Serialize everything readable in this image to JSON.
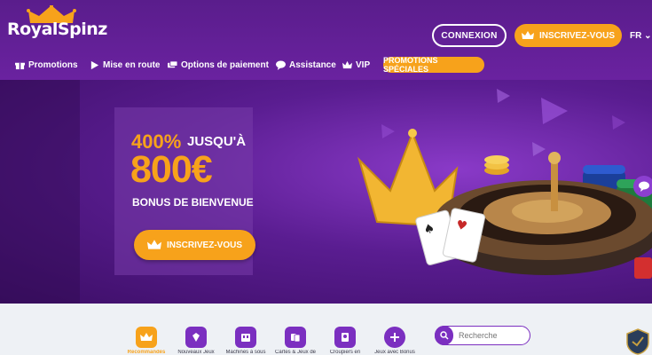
{
  "logo": {
    "text": "RoyalSpinz"
  },
  "header": {
    "login_label": "CONNEXION",
    "signup_label": "INSCRIVEZ-VOUS",
    "language": "FR"
  },
  "nav": {
    "items": [
      {
        "label": "Promotions",
        "icon": "gift-icon"
      },
      {
        "label": "Mise en route",
        "icon": "play-icon"
      },
      {
        "label": "Options de paiement",
        "icon": "payment-icon"
      },
      {
        "label": "Assistance",
        "icon": "chat-icon"
      },
      {
        "label": "VIP",
        "icon": "crown-icon"
      }
    ],
    "special_label": "PROMOTIONS SPÉCIALES"
  },
  "hero": {
    "percent": "400%",
    "upto": "JUSQU'À",
    "amount": "800€",
    "bonus": "BONUS DE BIENVENUE",
    "cta_label": "INSCRIVEZ-VOUS"
  },
  "categories": [
    {
      "label": "Recommandés",
      "icon": "crown-icon",
      "active": true
    },
    {
      "label": "Nouveaux Jeux",
      "icon": "gem-icon",
      "active": false
    },
    {
      "label": "Machines à sous",
      "icon": "slot-machine-icon",
      "active": false
    },
    {
      "label": "Cartes & Jeux de",
      "icon": "cards-icon",
      "active": false
    },
    {
      "label": "Croupiers en",
      "icon": "dealer-icon",
      "active": false
    },
    {
      "label": "Jeux avec Bonus",
      "icon": "plus-icon",
      "active": false
    }
  ],
  "search": {
    "placeholder": "Recherche"
  },
  "colors": {
    "brand_purple": "#6a22a0",
    "accent_orange": "#f7a21b"
  }
}
